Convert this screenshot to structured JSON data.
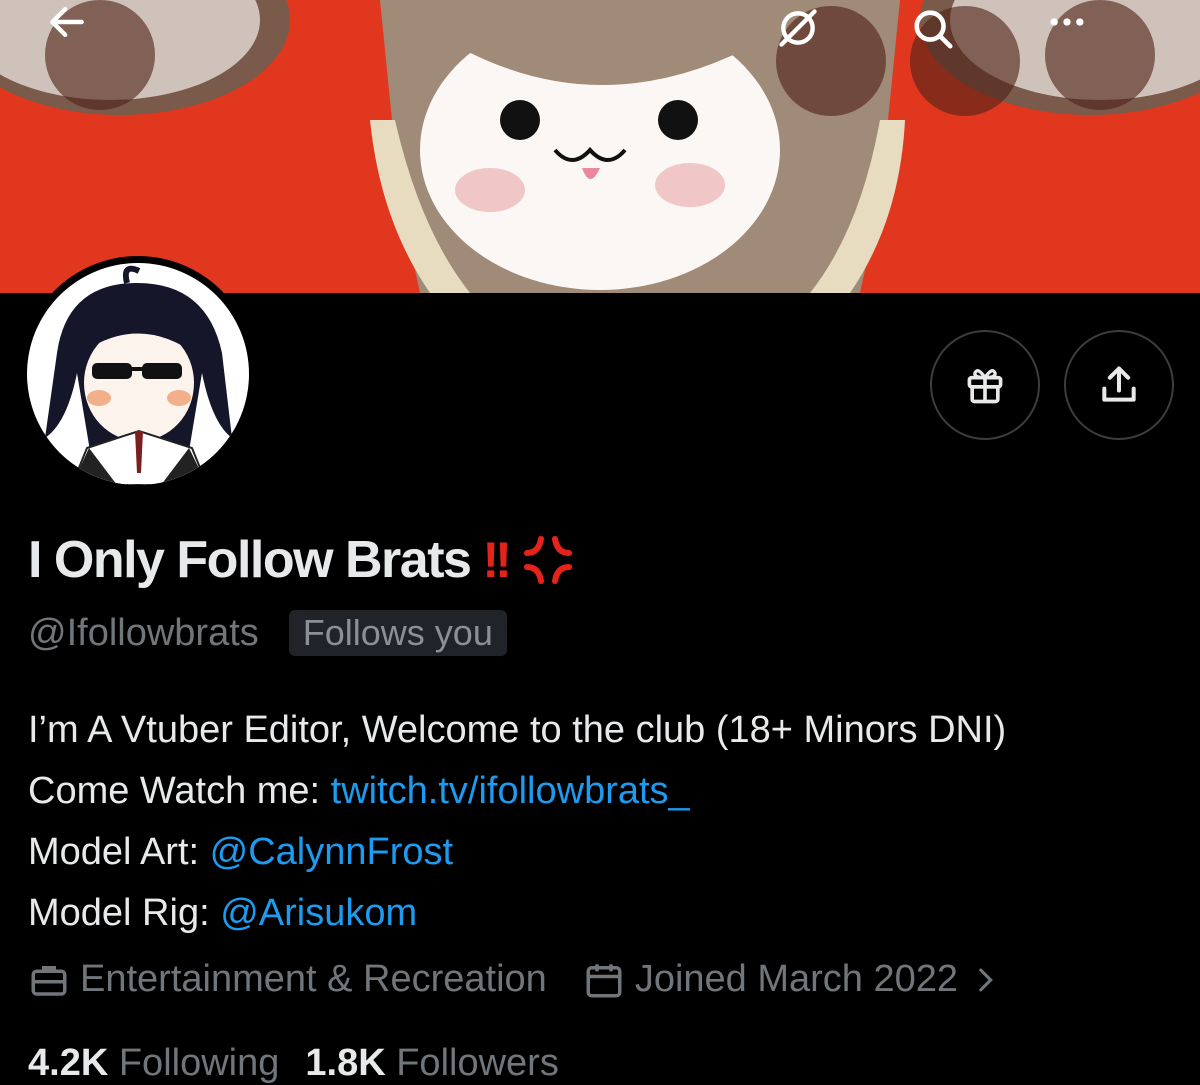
{
  "header": {
    "back_icon": "arrow-left-icon",
    "grok_icon": "grok-icon",
    "search_icon": "search-icon",
    "more_icon": "more-horizontal-icon"
  },
  "actions": {
    "gift_icon": "gift-icon",
    "share_icon": "share-icon"
  },
  "profile": {
    "display_name": "I Only Follow Brats",
    "name_emoji_exclaim": "!!",
    "name_emoji_anger": "anger-symbol-icon",
    "handle": "@Ifollowbrats",
    "follows_you": "Follows you",
    "bio": {
      "line1": "I’m A Vtuber Editor, Welcome to the club (18+ Minors DNI)",
      "line2_prefix": "Come Watch me: ",
      "line2_link": "twitch.tv/ifollowbrats_",
      "line3_prefix": "Model Art: ",
      "line3_link": "@CalynnFrost",
      "line4_prefix": "Model Rig: ",
      "line4_link": "@Arisukom"
    },
    "category": "Entertainment & Recreation",
    "joined": "Joined March 2022",
    "following_count": "4.2K",
    "following_label": "Following",
    "followers_count": "1.8K",
    "followers_label": "Followers"
  },
  "colors": {
    "banner": "#e2371f",
    "link": "#1d9bf0",
    "accent_red": "#e5231b",
    "muted": "#71767b"
  }
}
